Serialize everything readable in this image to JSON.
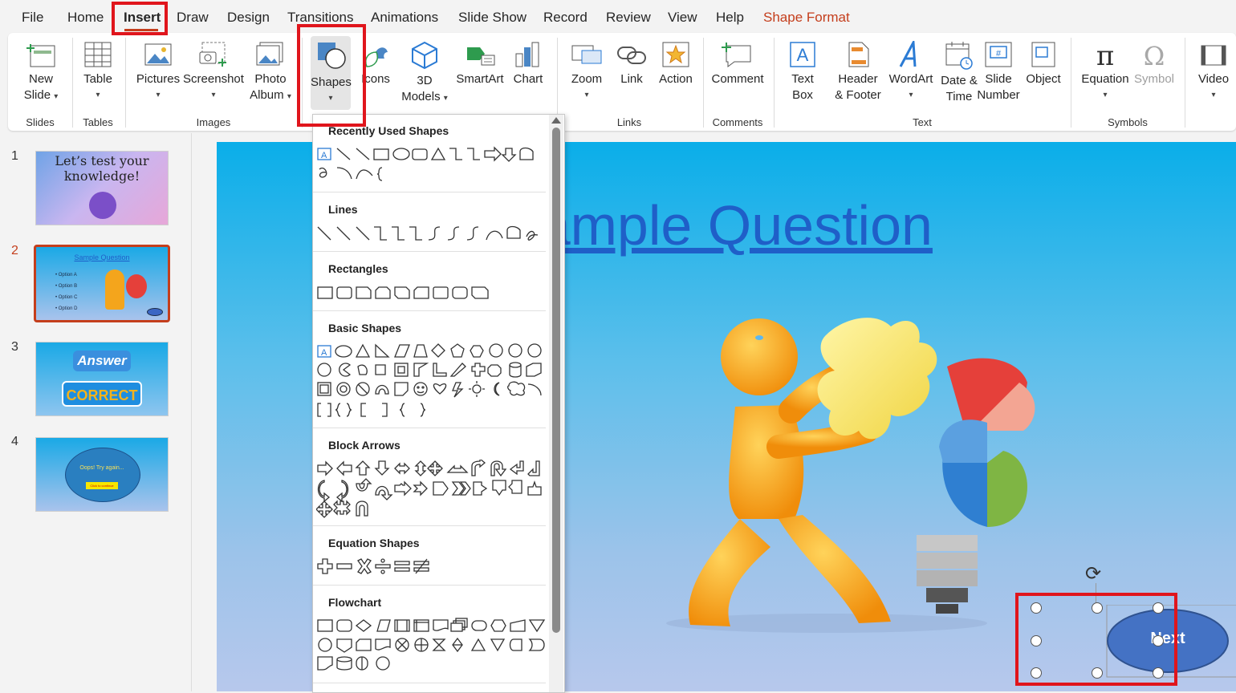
{
  "menu": {
    "tabs": [
      {
        "label": "File"
      },
      {
        "label": "Home"
      },
      {
        "label": "Insert"
      },
      {
        "label": "Draw"
      },
      {
        "label": "Design"
      },
      {
        "label": "Transitions"
      },
      {
        "label": "Animations"
      },
      {
        "label": "Slide Show"
      },
      {
        "label": "Record"
      },
      {
        "label": "Review"
      },
      {
        "label": "View"
      },
      {
        "label": "Help"
      },
      {
        "label": "Shape Format"
      }
    ],
    "active_tab": "Insert",
    "accent_color": "#c43e1c"
  },
  "ribbon": {
    "new_slide": {
      "line1": "New",
      "line2": "Slide"
    },
    "table": "Table",
    "pictures": "Pictures",
    "screenshot": "Screenshot",
    "photo_album": {
      "line1": "Photo",
      "line2": "Album"
    },
    "shapes": "Shapes",
    "icons": "Icons",
    "models": {
      "line1": "3D",
      "line2": "Models"
    },
    "smartart": "SmartArt",
    "chart": "Chart",
    "zoom": "Zoom",
    "link": "Link",
    "action": "Action",
    "comment": "Comment",
    "text_box": {
      "line1": "Text",
      "line2": "Box"
    },
    "header_footer": {
      "line1": "Header",
      "line2": "& Footer"
    },
    "wordart": "WordArt",
    "date_time": {
      "line1": "Date &",
      "line2": "Time"
    },
    "slide_number": {
      "line1": "Slide",
      "line2": "Number"
    },
    "object": "Object",
    "equation": "Equation",
    "symbol": "Symbol",
    "video": "Video",
    "groups": {
      "slides": "Slides",
      "tables": "Tables",
      "images": "Images",
      "links": "Links",
      "comments": "Comments",
      "text": "Text",
      "symbols": "Symbols"
    }
  },
  "thumbnails": [
    {
      "num": "1",
      "text1": "Let’s test your",
      "text2": "knowledge!"
    },
    {
      "num": "2",
      "title": "Sample Question",
      "options": [
        "• Option A",
        "• Option B",
        "• Option C",
        "• Option D"
      ]
    },
    {
      "num": "3",
      "text1": "Answer",
      "text2": "CORRECT"
    },
    {
      "num": "4",
      "text1": "Oops! Try again...",
      "text2": "Click to continue"
    }
  ],
  "slide": {
    "title": "Sample Question",
    "button_label": "Next"
  },
  "shapes_gallery": {
    "sections": [
      "Recently Used Shapes",
      "Lines",
      "Rectangles",
      "Basic Shapes",
      "Block Arrows",
      "Equation Shapes",
      "Flowchart"
    ]
  },
  "colors": {
    "highlight_red": "#e0151c",
    "slide_title_blue": "#1f5fc8",
    "button_fill": "#4472c4"
  }
}
